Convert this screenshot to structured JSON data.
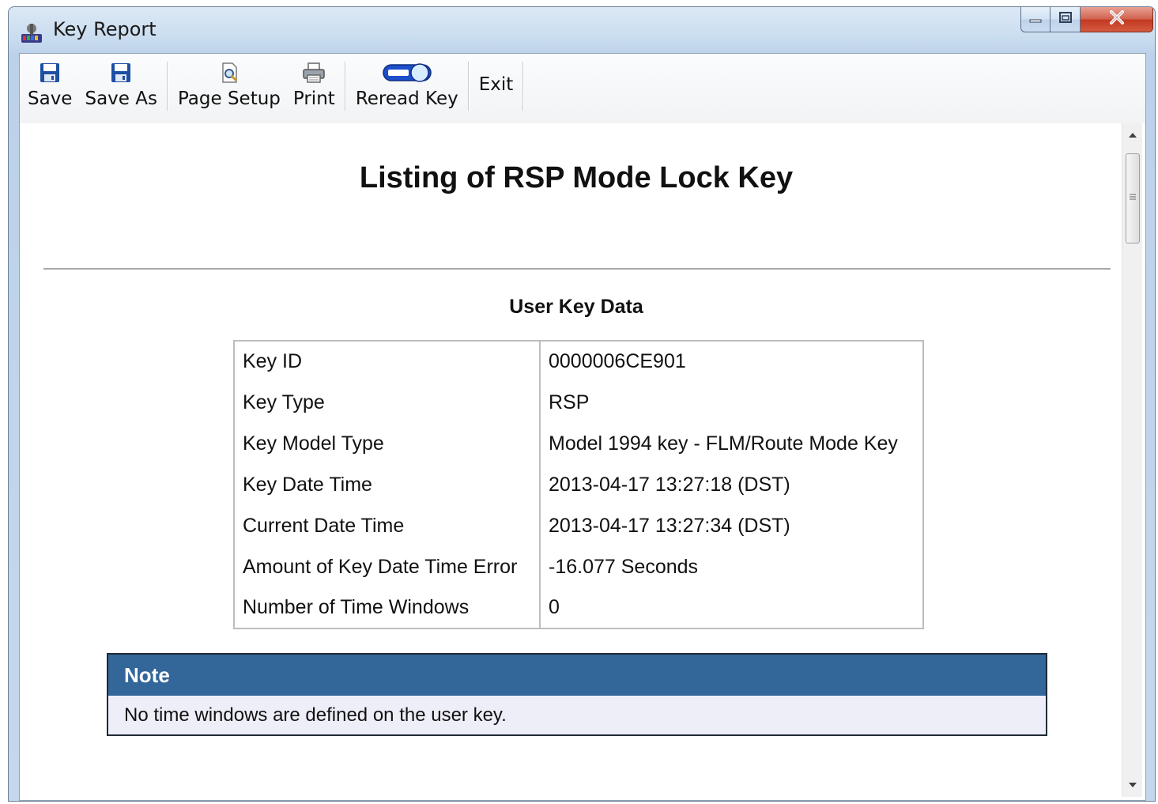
{
  "window": {
    "title": "Key Report",
    "controls": {
      "minimize_icon": "minimize-icon",
      "maximize_icon": "maximize-icon",
      "close_icon": "close-icon"
    }
  },
  "toolbar": {
    "items": [
      {
        "label": "Save",
        "icon": "floppy-disk-icon"
      },
      {
        "label": "Save As",
        "icon": "floppy-disk-icon"
      },
      {
        "label": "Page Setup",
        "icon": "page-magnifier-icon"
      },
      {
        "label": "Print",
        "icon": "printer-icon"
      },
      {
        "label": "Reread Key",
        "icon": "key-toggle-icon"
      },
      {
        "label": "Exit"
      }
    ]
  },
  "report": {
    "title": "Listing of RSP Mode Lock Key",
    "section_title": "User Key Data",
    "rows": [
      {
        "key": "Key ID",
        "value": "0000006CE901"
      },
      {
        "key": "Key Type",
        "value": "RSP"
      },
      {
        "key": "Key Model Type",
        "value": "Model 1994 key - FLM/Route Mode Key"
      },
      {
        "key": "Key Date Time",
        "value": "2013-04-17 13:27:18 (DST)"
      },
      {
        "key": "Current Date Time",
        "value": "2013-04-17 13:27:34 (DST)"
      },
      {
        "key": "Amount of Key Date Time Error",
        "value": "-16.077 Seconds"
      },
      {
        "key": "Number of Time Windows",
        "value": "0"
      }
    ],
    "note": {
      "heading": "Note",
      "text": "No time windows are defined on the user key."
    }
  },
  "colors": {
    "note_header_bg": "#336699",
    "note_body_bg": "#eeeef8",
    "close_button": "#c2381f"
  }
}
